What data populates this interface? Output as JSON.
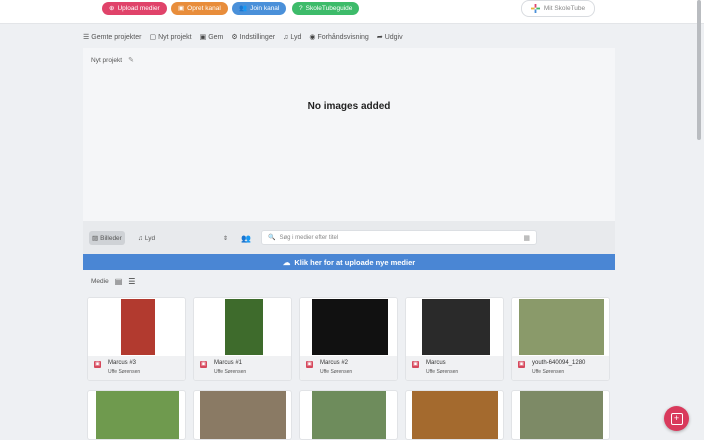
{
  "topbar": {
    "buttons": [
      {
        "label": "Upload medier",
        "icon": "plus-circle-icon",
        "color": "#e0436a"
      },
      {
        "label": "Opret kanal",
        "icon": "tv-icon",
        "color": "#e88d3b"
      },
      {
        "label": "Join kanal",
        "icon": "users-icon",
        "color": "#4a90d9"
      },
      {
        "label": "SkoleTubeguide",
        "icon": "question-circle-icon",
        "color": "#3dbb6a"
      }
    ],
    "brand_label": "Mit SkoleTube"
  },
  "toolbar": {
    "items": [
      {
        "label": "Gemte projekter",
        "icon": "list-icon",
        "glyph": "☰"
      },
      {
        "label": "Nyt projekt",
        "icon": "new-file-icon",
        "glyph": "▢"
      },
      {
        "label": "Gem",
        "icon": "save-icon",
        "glyph": "▣"
      },
      {
        "label": "Indstillinger",
        "icon": "settings-icon",
        "glyph": "⚙"
      },
      {
        "label": "Lyd",
        "icon": "music-icon",
        "glyph": "♫"
      },
      {
        "label": "Forhåndsvisning",
        "icon": "eye-icon",
        "glyph": "◉"
      },
      {
        "label": "Udgiv",
        "icon": "share-icon",
        "glyph": "➦"
      }
    ]
  },
  "preview": {
    "project_title": "Nyt projekt",
    "empty_message": "No images added"
  },
  "filter": {
    "images_label": "Billeder",
    "audio_label": "Lyd",
    "search_placeholder": "Søg i medier efter titel"
  },
  "upload_banner": "Klik her for at uploade nye medier",
  "media": {
    "label": "Medie",
    "cards": [
      {
        "title": "Marcus #3",
        "owner": "Uffe Sørensen",
        "thumb_color": "#b23a2f"
      },
      {
        "title": "Marcus #1",
        "owner": "Uffe Sørensen",
        "thumb_color": "#3e6b2c"
      },
      {
        "title": "Marcus #2",
        "owner": "Uffe Sørensen",
        "thumb_color": "#111111"
      },
      {
        "title": "Marcus",
        "owner": "Uffe Sørensen",
        "thumb_color": "#2a2a2a"
      },
      {
        "title": "youth-640094_1280",
        "owner": "Uffe Sørensen",
        "thumb_color": "#8a9a6a"
      }
    ],
    "second_row_colors": [
      "#6f9a4e",
      "#8a7a64",
      "#6e8c5c",
      "#a46a2e",
      "#7d8a66"
    ]
  }
}
